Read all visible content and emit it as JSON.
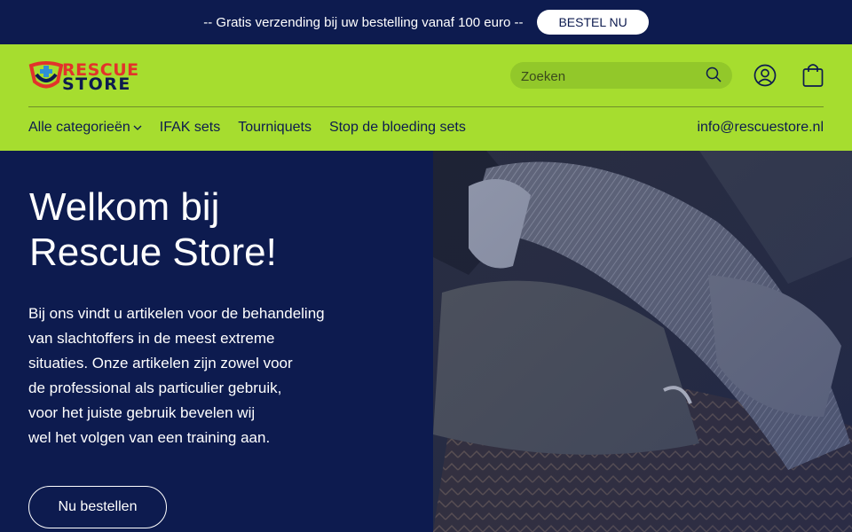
{
  "announcement": {
    "text": "-- Gratis verzending bij uw bestelling vanaf 100 euro --",
    "button": "BESTEL NU"
  },
  "logo": {
    "line1": "RESCUE",
    "line2": "STORE"
  },
  "search": {
    "placeholder": "Zoeken",
    "icon": "search-icon"
  },
  "header_icons": {
    "account": "account-icon",
    "cart": "shopping-bag-icon"
  },
  "nav": {
    "items": [
      {
        "label": "Alle categorieën",
        "has_dropdown": true
      },
      {
        "label": "IFAK sets"
      },
      {
        "label": "Tourniquets"
      },
      {
        "label": "Stop de bloeding sets"
      }
    ],
    "email": "info@rescuestore.nl"
  },
  "hero": {
    "title_line1": "Welkom bij",
    "title_line2": "Rescue Store!",
    "lines": [
      "Bij ons vindt u artikelen voor de behandeling",
      "van slachtoffers in de meest extreme",
      "situaties. Onze artikelen zijn zowel voor",
      "de professional als particulier gebruik,",
      "voor het juiste gebruik bevelen wij",
      "wel het volgen van een training aan."
    ],
    "button": "Nu bestellen"
  },
  "colors": {
    "navy": "#0d1b4f",
    "lime": "#a6dd2f",
    "logo_red": "#e2332b",
    "white": "#ffffff"
  }
}
